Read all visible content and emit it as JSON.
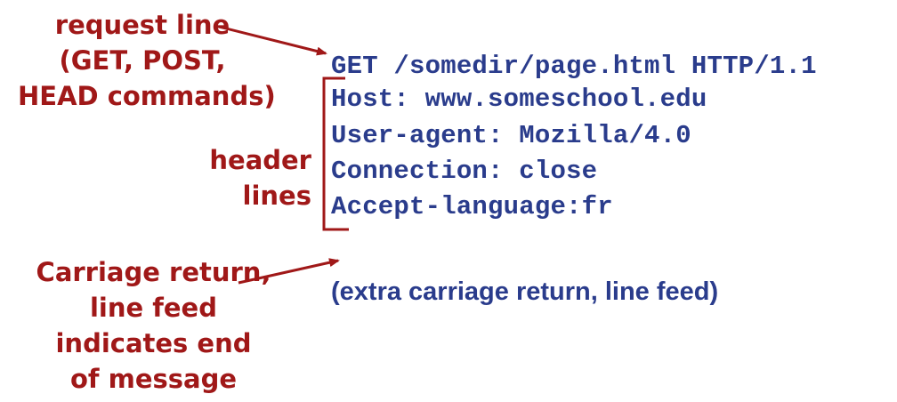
{
  "labels": {
    "request_line": [
      "request line",
      "(GET, POST,",
      "HEAD commands)"
    ],
    "header_lines": [
      "header",
      "lines"
    ],
    "crlf": [
      "Carriage return,",
      "line feed",
      "indicates end",
      "of message"
    ]
  },
  "http_message": {
    "request_line": "GET /somedir/page.html HTTP/1.1",
    "headers": [
      "Host: www.someschool.edu",
      "User-agent: Mozilla/4.0",
      "Connection: close",
      "Accept-language:fr"
    ],
    "extra_line": "(extra carriage return, line feed)"
  },
  "colors": {
    "annotation": "#a01818",
    "message_text": "#2a3c8c"
  }
}
